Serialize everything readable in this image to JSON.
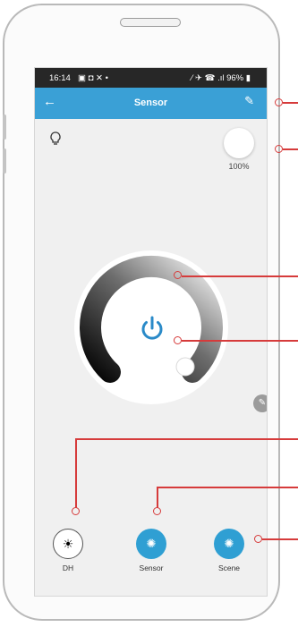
{
  "status_bar": {
    "time": "16:14",
    "left_icons": "▣ ◘ ✕ •",
    "right_icons": "⁄ ✈ ☎ .ıl",
    "battery": "96%"
  },
  "app_bar": {
    "title": "Sensor",
    "back_icon": "arrow-left-icon",
    "edit_icon": "pencil-icon"
  },
  "light": {
    "brightness_label": "100%",
    "brightness_value": 100
  },
  "modes": [
    {
      "label": "DH",
      "active": false
    },
    {
      "label": "Sensor",
      "active": true
    },
    {
      "label": "Scene",
      "active": true
    }
  ],
  "colors": {
    "accent": "#3aa0d6",
    "callout": "#d63b3b",
    "power": "#2a8ac8"
  }
}
